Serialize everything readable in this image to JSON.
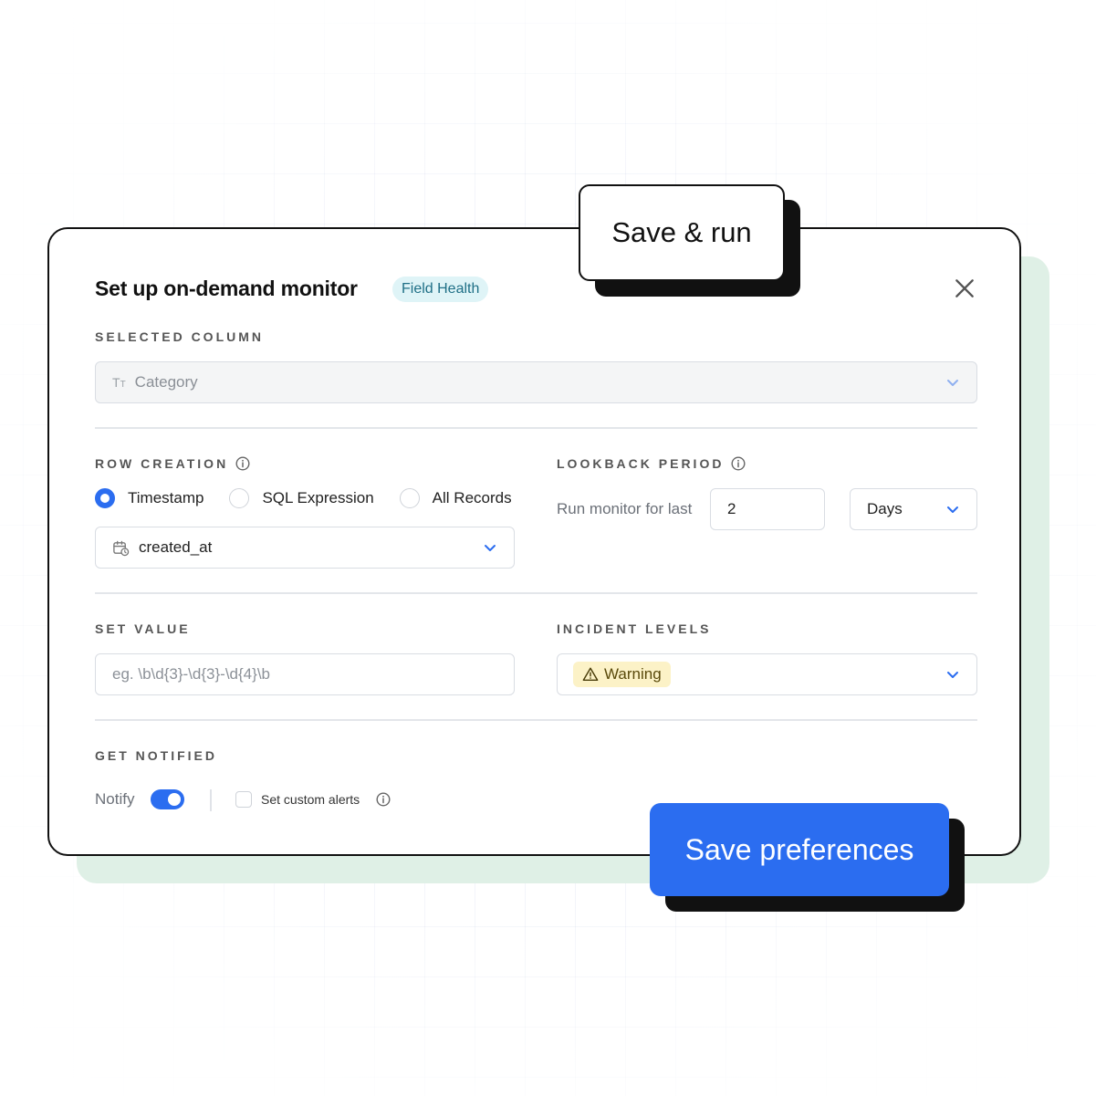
{
  "modal": {
    "title": "Set up on-demand monitor",
    "badge": "Field Health"
  },
  "selected_column": {
    "label": "SELECTED COLUMN",
    "value": "Category",
    "icon": "text-type-icon"
  },
  "row_creation": {
    "label": "ROW CREATION",
    "options": [
      "Timestamp",
      "SQL Expression",
      "All Records"
    ],
    "selected": "Timestamp",
    "field_value": "created_at",
    "icon": "calendar-clock-icon"
  },
  "lookback": {
    "label": "LOOKBACK PERIOD",
    "prefix": "Run monitor for last",
    "amount": "2",
    "unit": "Days"
  },
  "set_value": {
    "label": "SET VALUE",
    "placeholder": "eg. \\b\\d{3}-\\d{3}-\\d{4}\\b"
  },
  "incident_levels": {
    "label": "INCIDENT LEVELS",
    "value": "Warning",
    "icon": "warning-triangle-icon"
  },
  "notify": {
    "label": "GET NOTIFIED",
    "toggle_label": "Notify",
    "toggle_on": true,
    "custom_alerts_label": "Set custom alerts",
    "custom_alerts_checked": false
  },
  "buttons": {
    "save_run": "Save & run",
    "save_preferences": "Save preferences"
  },
  "colors": {
    "primary": "#2b6df0",
    "badge_bg": "#dff4f7",
    "warning_bg": "#fcf2c7",
    "shadow_green": "#dff0e6"
  }
}
